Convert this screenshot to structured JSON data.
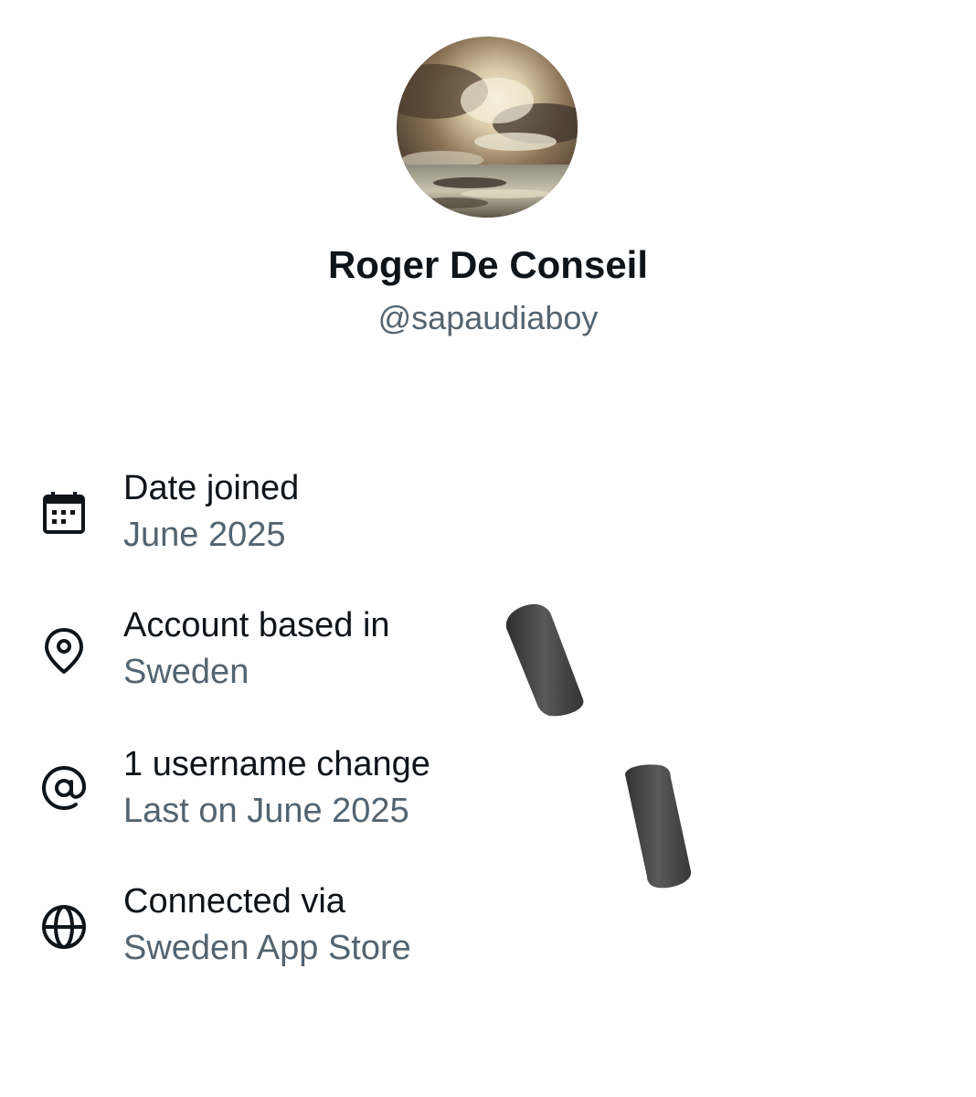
{
  "profile": {
    "display_name": "Roger De Conseil",
    "handle": "@sapaudiaboy"
  },
  "about": {
    "items": [
      {
        "icon": "calendar-icon",
        "label": "Date joined",
        "value": "June 2025"
      },
      {
        "icon": "location-pin-icon",
        "label": "Account based in",
        "value": "Sweden"
      },
      {
        "icon": "at-sign-icon",
        "label": "1 username change",
        "value": "Last on June 2025"
      },
      {
        "icon": "globe-icon",
        "label": "Connected via",
        "value": "Sweden App Store"
      }
    ]
  },
  "colors": {
    "primary_text": "#0f1419",
    "secondary_text": "#536471",
    "background": "#ffffff"
  }
}
